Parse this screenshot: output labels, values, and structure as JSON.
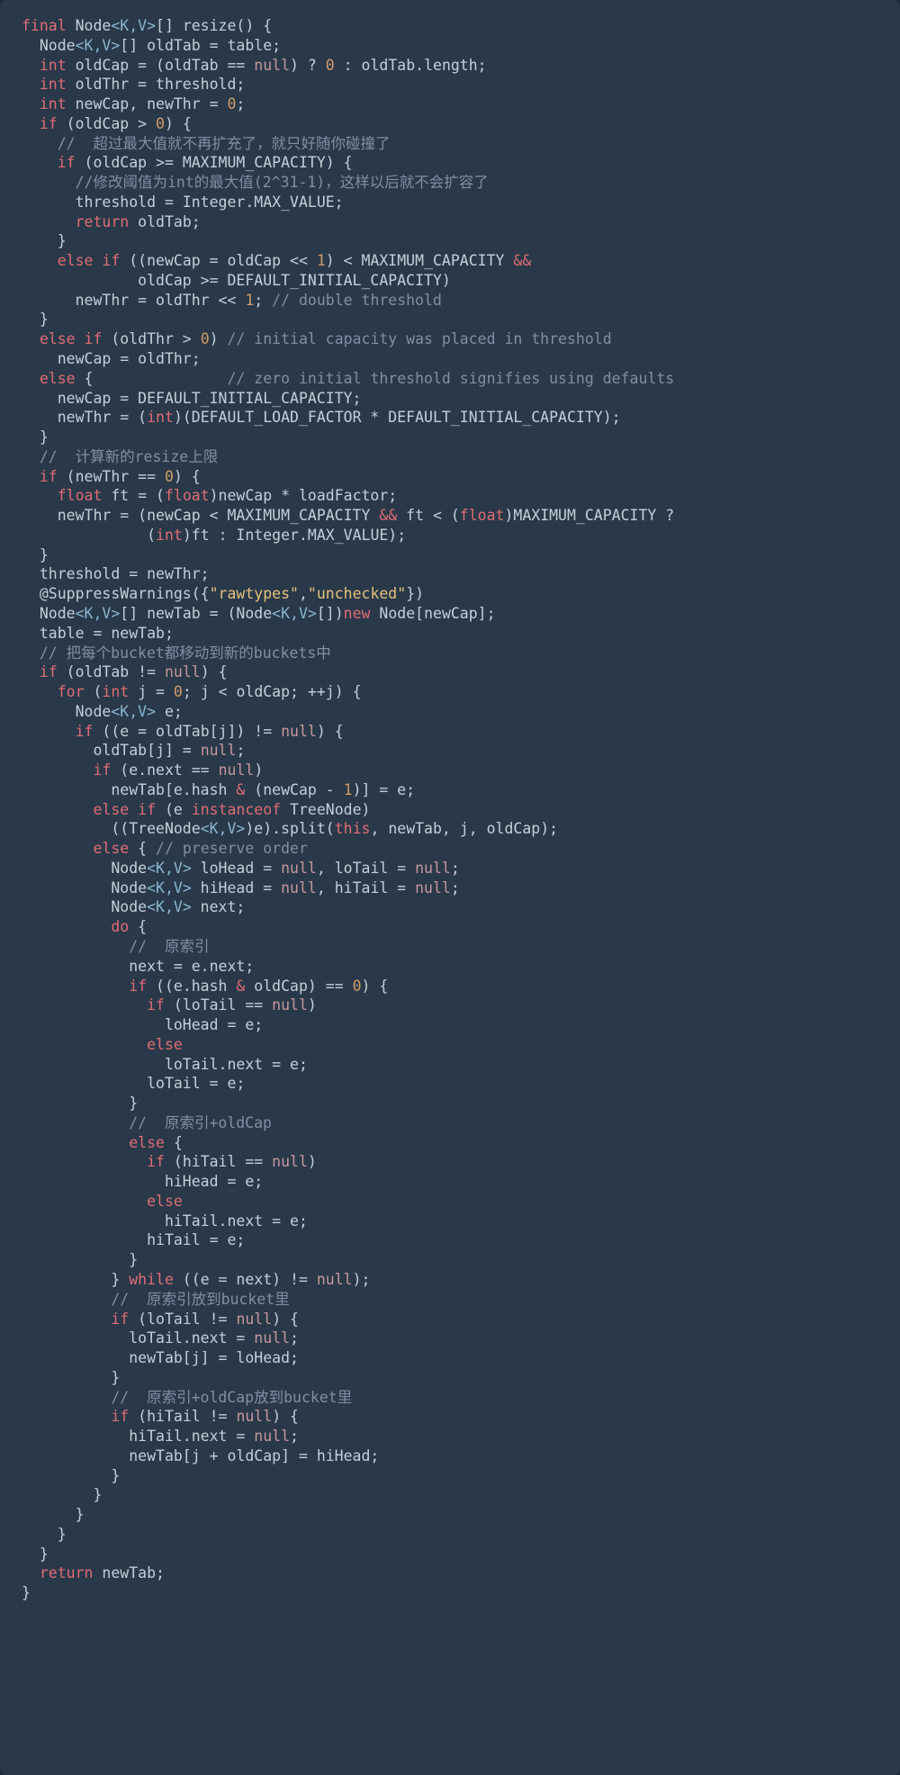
{
  "code": {
    "l01": "final",
    "l01b": " Node",
    "l01c": "<K,V>",
    "l01d": "[] resize() {",
    "l02": "  Node",
    "l02b": "<K,V>",
    "l02c": "[] oldTab = table;",
    "l03": "  int",
    "l03b": " oldCap = (oldTab == ",
    "l03c": "null",
    "l03d": ") ? ",
    "l03e": "0",
    "l03f": " : oldTab.length;",
    "l04": "  int",
    "l04b": " oldThr = threshold;",
    "l05": "  int",
    "l05b": " newCap, newThr = ",
    "l05c": "0",
    "l05d": ";",
    "l06": "  if",
    "l06b": " (oldCap > ",
    "l06c": "0",
    "l06d": ") {",
    "l07": "    //  超过最大值就不再扩充了，就只好随你碰撞了",
    "l08": "    if",
    "l08b": " (oldCap >= MAXIMUM_CAPACITY) {",
    "l09": "      //修改阈值为int的最大值(2^31-1)，这样以后就不会扩容了",
    "l10": "      threshold = Integer.MAX_VALUE;",
    "l11": "      return",
    "l11b": " oldTab;",
    "l12": "    }",
    "l13": "    else if",
    "l13b": " ((newCap = oldCap << ",
    "l13c": "1",
    "l13d": ") < MAXIMUM_CAPACITY ",
    "l13e": "&&",
    "l14": "             oldCap >= DEFAULT_INITIAL_CAPACITY)",
    "l15": "      newThr = oldThr << ",
    "l15b": "1",
    "l15c": "; ",
    "l15d": "// double threshold",
    "l16": "  }",
    "l17": "  else if",
    "l17b": " (oldThr > ",
    "l17c": "0",
    "l17d": ") ",
    "l17e": "// initial capacity was placed in threshold",
    "l18": "    newCap = oldThr;",
    "l19": "  else",
    "l19b": " {               ",
    "l19c": "// zero initial threshold signifies using defaults",
    "l20": "    newCap = DEFAULT_INITIAL_CAPACITY;",
    "l21": "    newThr = (",
    "l21b": "int",
    "l21c": ")(DEFAULT_LOAD_FACTOR * DEFAULT_INITIAL_CAPACITY);",
    "l22": "  }",
    "l23": "  //  计算新的resize上限",
    "l24": "  if",
    "l24b": " (newThr == ",
    "l24c": "0",
    "l24d": ") {",
    "l25": "    float",
    "l25b": " ft = (",
    "l25c": "float",
    "l25d": ")newCap * loadFactor;",
    "l26": "    newThr = (newCap < MAXIMUM_CAPACITY ",
    "l26b": "&&",
    "l26c": " ft < (",
    "l26d": "float",
    "l26e": ")MAXIMUM_CAPACITY ?",
    "l27": "              (",
    "l27b": "int",
    "l27c": ")ft : Integer.MAX_VALUE);",
    "l28": "  }",
    "l29": "  threshold = newThr;",
    "l30": "  @SuppressWarnings({",
    "l30b": "\"rawtypes\"",
    "l30c": ",",
    "l30d": "\"unchecked\"",
    "l30e": "})",
    "l31": "  Node",
    "l31b": "<K,V>",
    "l31c": "[] newTab = (Node",
    "l31d": "<K,V>",
    "l31e": "[])",
    "l31f": "new",
    "l31g": " Node[newCap];",
    "l32": "  table = newTab;",
    "l33": "  // 把每个bucket都移动到新的buckets中",
    "l34": "  if",
    "l34b": " (oldTab != ",
    "l34c": "null",
    "l34d": ") {",
    "l35": "    for",
    "l35b": " (",
    "l35c": "int",
    "l35d": " j = ",
    "l35e": "0",
    "l35f": "; j < oldCap; ++j) {",
    "l36": "      Node",
    "l36b": "<K,V>",
    "l36c": " e;",
    "l37": "      if",
    "l37b": " ((e = oldTab[j]) != ",
    "l37c": "null",
    "l37d": ") {",
    "l38": "        oldTab[j] = ",
    "l38b": "null",
    "l38c": ";",
    "l39": "        if",
    "l39b": " (e.next == ",
    "l39c": "null",
    "l39d": ")",
    "l40": "          newTab[e.hash ",
    "l40b": "&",
    "l40c": " (newCap - ",
    "l40d": "1",
    "l40e": ")] = e;",
    "l41": "        else if",
    "l41b": " (e ",
    "l41c": "instanceof",
    "l41d": " TreeNode)",
    "l42": "          ((TreeNode",
    "l42b": "<K,V>",
    "l42c": ")e).split(",
    "l42d": "this",
    "l42e": ", newTab, j, oldCap);",
    "l43": "        else",
    "l43b": " { ",
    "l43c": "// preserve order",
    "l44": "          Node",
    "l44b": "<K,V>",
    "l44c": " loHead = ",
    "l44d": "null",
    "l44e": ", loTail = ",
    "l44f": "null",
    "l44g": ";",
    "l45": "          Node",
    "l45b": "<K,V>",
    "l45c": " hiHead = ",
    "l45d": "null",
    "l45e": ", hiTail = ",
    "l45f": "null",
    "l45g": ";",
    "l46": "          Node",
    "l46b": "<K,V>",
    "l46c": " next;",
    "l47": "          do",
    "l47b": " {",
    "l48": "            //  原索引",
    "l49": "            next = e.next;",
    "l50": "            if",
    "l50b": " ((e.hash ",
    "l50c": "&",
    "l50d": " oldCap) == ",
    "l50e": "0",
    "l50f": ") {",
    "l51": "              if",
    "l51b": " (loTail == ",
    "l51c": "null",
    "l51d": ")",
    "l52": "                loHead = e;",
    "l53": "              else",
    "l54": "                loTail.next = e;",
    "l55": "              loTail = e;",
    "l56": "            }",
    "l57": "            //  原索引+oldCap",
    "l58": "            else",
    "l58b": " {",
    "l59": "              if",
    "l59b": " (hiTail == ",
    "l59c": "null",
    "l59d": ")",
    "l60": "                hiHead = e;",
    "l61": "              else",
    "l62": "                hiTail.next = e;",
    "l63": "              hiTail = e;",
    "l64": "            }",
    "l65": "          } ",
    "l65b": "while",
    "l65c": " ((e = next) != ",
    "l65d": "null",
    "l65e": ");",
    "l66": "          //  原索引放到bucket里",
    "l67": "          if",
    "l67b": " (loTail != ",
    "l67c": "null",
    "l67d": ") {",
    "l68": "            loTail.next = ",
    "l68b": "null",
    "l68c": ";",
    "l69": "            newTab[j] = loHead;",
    "l70": "          }",
    "l71": "          //  原索引+oldCap放到bucket里",
    "l72": "          if",
    "l72b": " (hiTail != ",
    "l72c": "null",
    "l72d": ") {",
    "l73": "            hiTail.next = ",
    "l73b": "null",
    "l73c": ";",
    "l74": "            newTab[j + oldCap] = hiHead;",
    "l75": "          }",
    "l76": "        }",
    "l77": "      }",
    "l78": "    }",
    "l79": "  }",
    "l80": "  return",
    "l80b": " newTab;",
    "l81": "}"
  }
}
